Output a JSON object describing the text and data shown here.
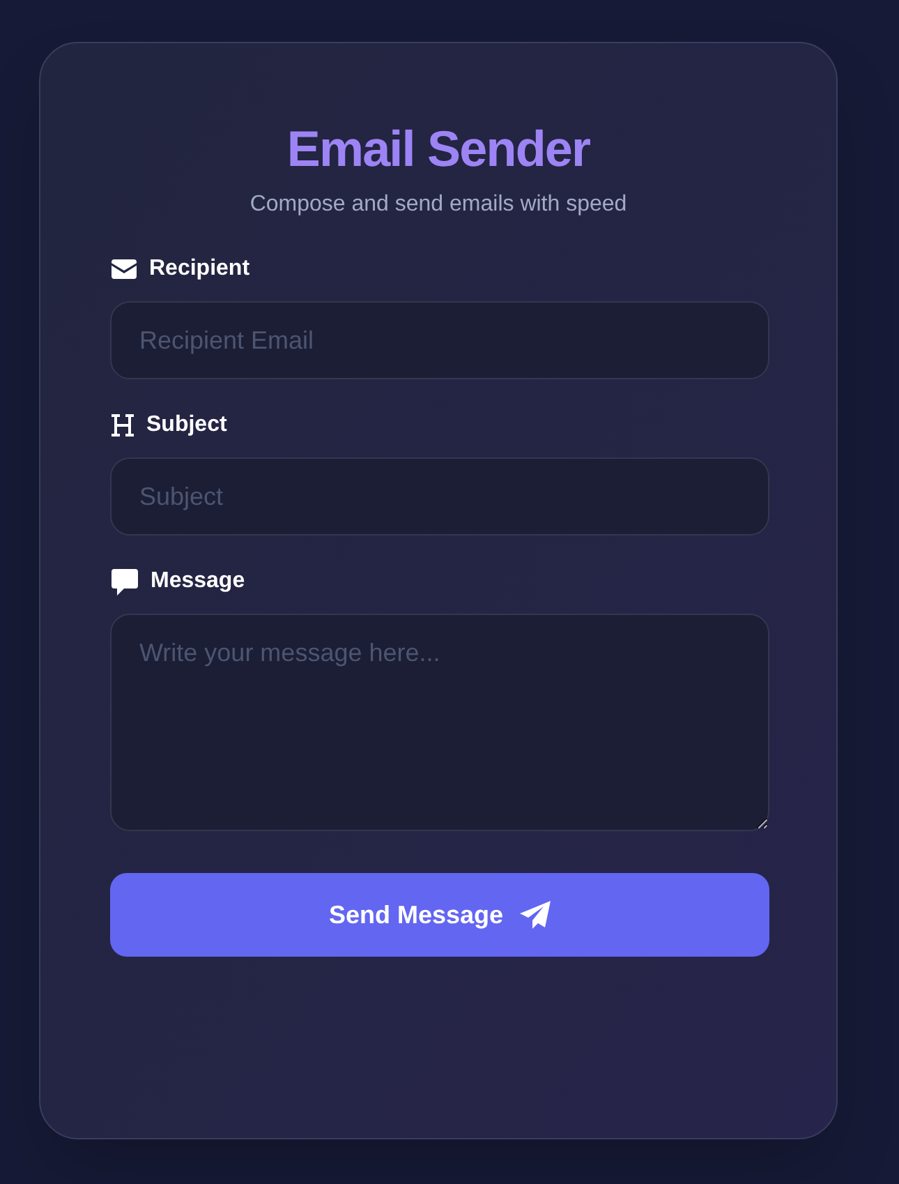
{
  "header": {
    "title": "Email Sender",
    "subtitle": "Compose and send emails with speed"
  },
  "fields": [
    {
      "kind": "input",
      "label": "Recipient",
      "placeholder": "Recipient Email"
    },
    {
      "kind": "input",
      "label": "Subject",
      "placeholder": "Subject"
    },
    {
      "kind": "textarea",
      "label": "Message",
      "placeholder": "Write your message here..."
    }
  ],
  "submit": {
    "label": "Send Message"
  }
}
